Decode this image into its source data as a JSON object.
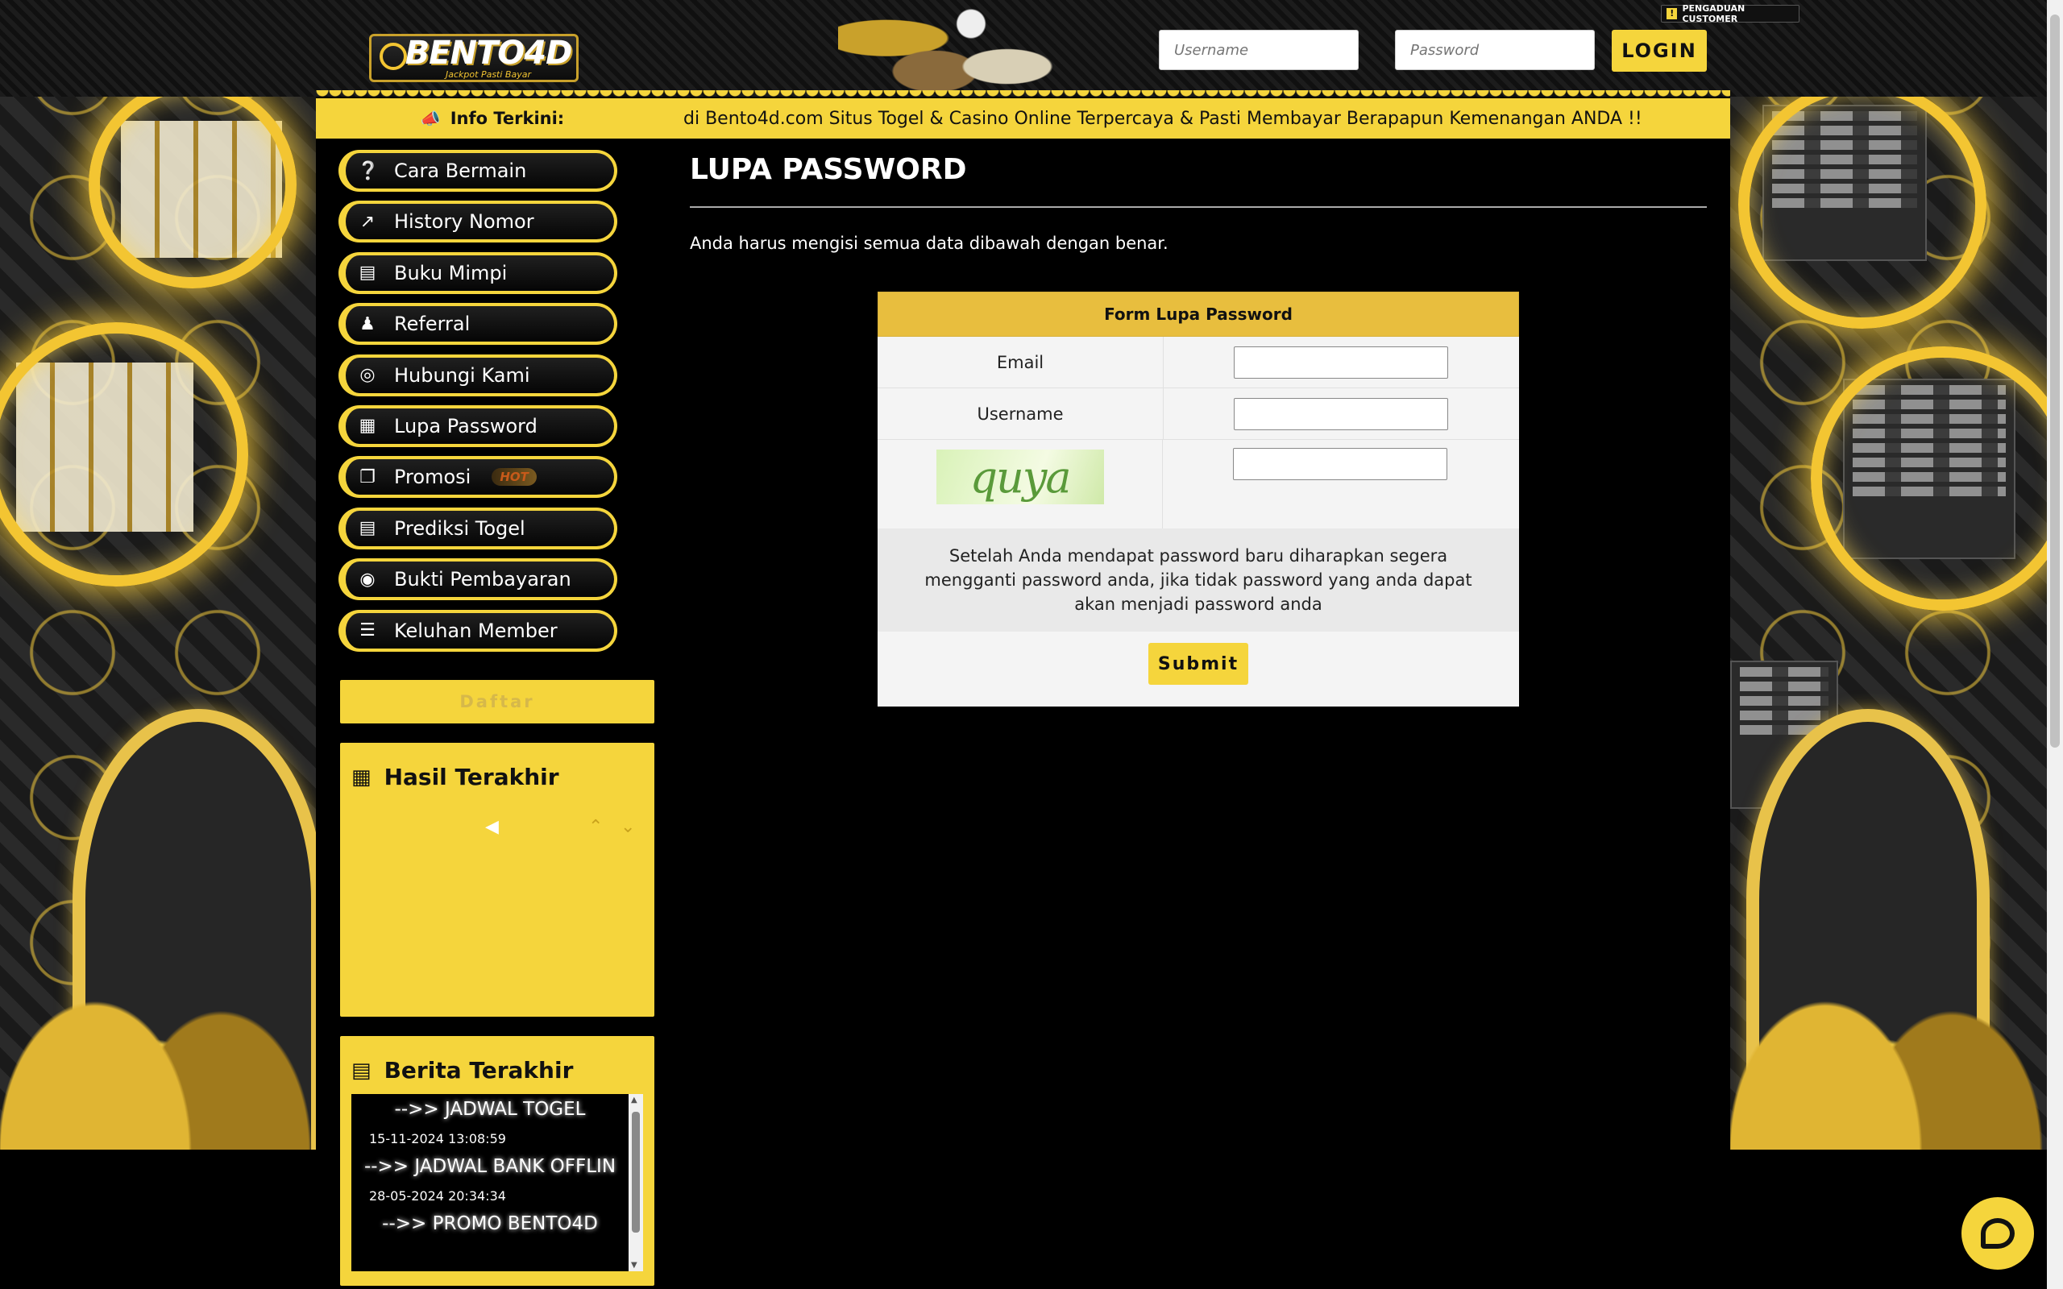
{
  "header": {
    "logo_text": "BENTO4D",
    "logo_tagline": "Jackpot Pasti Bayar",
    "username_placeholder": "Username",
    "password_placeholder": "Password",
    "login_label": "LOGIN",
    "complaint_label": "PENGADUAN CUSTOMER"
  },
  "infobar": {
    "label": "Info Terkini:",
    "marquee": "di Bento4d.com Situs Togel & Casino Online Terpercaya & Pasti Membayar Berapapun Kemenangan ANDA !!"
  },
  "menu": {
    "items": [
      {
        "label": "Cara Bermain",
        "icon": "question-circle-icon"
      },
      {
        "label": "History Nomor",
        "icon": "line-chart-icon"
      },
      {
        "label": "Buku Mimpi",
        "icon": "newspaper-icon"
      },
      {
        "label": "Referral",
        "icon": "users-icon"
      },
      {
        "label": "Hubungi Kami",
        "icon": "chat-icon"
      },
      {
        "label": "Lupa Password",
        "icon": "calendar-icon"
      },
      {
        "label": "Promosi",
        "icon": "clone-icon",
        "badge": "HOT"
      },
      {
        "label": "Prediksi Togel",
        "icon": "newspaper-icon"
      },
      {
        "label": "Bukti Pembayaran",
        "icon": "money-icon"
      },
      {
        "label": "Keluhan Member",
        "icon": "list-icon"
      }
    ],
    "daftar_label": "Daftar"
  },
  "hasil": {
    "title": "Hasil Terakhir"
  },
  "berita": {
    "title": "Berita Terakhir",
    "items": [
      {
        "title": "-->> JADWAL TOGEL",
        "date": "15-11-2024 13:08:59"
      },
      {
        "title": "-->> JADWAL BANK OFFLIN",
        "date": "28-05-2024 20:34:34"
      },
      {
        "title": "-->> PROMO BENTO4D",
        "date": ""
      }
    ]
  },
  "main": {
    "title": "LUPA PASSWORD",
    "intro": "Anda harus mengisi semua data dibawah dengan benar.",
    "form": {
      "title": "Form Lupa Password",
      "email_label": "Email",
      "username_label": "Username",
      "captcha_text": "quya",
      "note": "Setelah Anda mendapat password baru diharapkan segera mengganti password anda, jika tidak password yang anda dapat akan menjadi password anda",
      "submit_label": "Submit"
    }
  },
  "colors": {
    "accent": "#f5d53c",
    "form_header": "#e8be3e",
    "background": "#000000"
  }
}
